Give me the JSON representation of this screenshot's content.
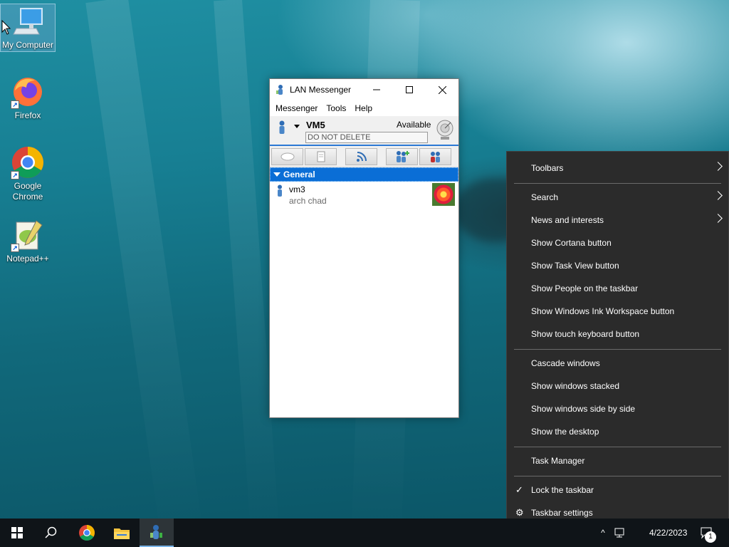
{
  "desktop": {
    "icons": [
      {
        "label": "My Computer",
        "icon": "computer-icon"
      },
      {
        "label": "Firefox",
        "icon": "firefox-icon"
      },
      {
        "label": "Google Chrome",
        "icon": "chrome-icon"
      },
      {
        "label": "Notepad++",
        "icon": "notepadpp-icon"
      }
    ]
  },
  "window": {
    "title": "LAN Messenger",
    "menu": [
      "Messenger",
      "Tools",
      "Help"
    ],
    "user": {
      "name": "VM5",
      "status": "Available",
      "note": "DO NOT DELETE"
    },
    "toolbar_icons": [
      "chat-icon",
      "file-icon",
      "broadcast-icon",
      "add-contact-icon",
      "group-icon"
    ],
    "group": "General",
    "contacts": [
      {
        "name": "vm3",
        "note": "arch chad"
      }
    ]
  },
  "context_menu": {
    "items": [
      {
        "label": "Toolbars",
        "submenu": true
      },
      {
        "label": "Search",
        "submenu": true
      },
      {
        "label": "News and interests",
        "submenu": true
      },
      {
        "label": "Show Cortana button"
      },
      {
        "label": "Show Task View button"
      },
      {
        "label": "Show People on the taskbar"
      },
      {
        "label": "Show Windows Ink Workspace button"
      },
      {
        "label": "Show touch keyboard button"
      },
      {
        "label": "Cascade windows"
      },
      {
        "label": "Show windows stacked"
      },
      {
        "label": "Show windows side by side"
      },
      {
        "label": "Show the desktop"
      },
      {
        "label": "Task Manager"
      },
      {
        "label": "Lock the taskbar",
        "checked": true
      },
      {
        "label": "Taskbar settings",
        "icon": "gear-icon"
      }
    ]
  },
  "taskbar": {
    "apps": [
      "start-icon",
      "search-icon",
      "chrome-icon",
      "file-explorer-icon",
      "lan-messenger-icon"
    ],
    "date": "4/22/2023",
    "notification_count": "1"
  },
  "colors": {
    "accent": "#0a6ed6",
    "menu_bg": "#2b2b2b",
    "taskbar_bg": "#0f1418"
  }
}
